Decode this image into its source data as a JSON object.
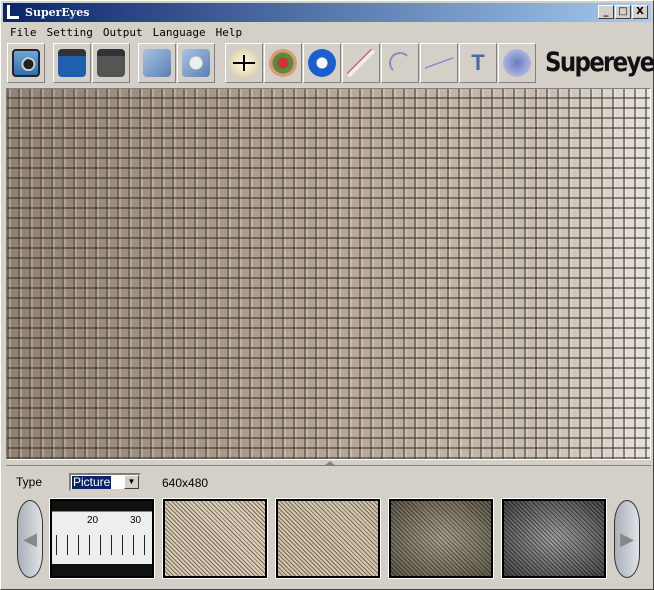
{
  "window": {
    "title": "SuperEyes",
    "minimize": "_",
    "maximize": "□",
    "close": "X"
  },
  "menu": [
    "File",
    "Setting",
    "Output",
    "Language",
    "Help"
  ],
  "toolbar": {
    "buttons": [
      {
        "name": "capture-photo",
        "icon": "camera-icon"
      },
      {
        "name": "start-record",
        "icon": "video-play-icon"
      },
      {
        "name": "stop-record",
        "icon": "video-stop-icon"
      },
      {
        "name": "open-photo-folder",
        "icon": "photo-folder-icon"
      },
      {
        "name": "open-video-folder",
        "icon": "video-folder-icon"
      },
      {
        "name": "crosshair",
        "icon": "crosshair-icon"
      },
      {
        "name": "settings",
        "icon": "gear-icon"
      },
      {
        "name": "play",
        "icon": "play-circle-icon"
      },
      {
        "name": "measure-line",
        "icon": "ruler-icon"
      },
      {
        "name": "measure-arc",
        "icon": "arc-icon"
      },
      {
        "name": "measure-angle",
        "icon": "angle-icon"
      },
      {
        "name": "text",
        "icon": "text-icon",
        "label": "T"
      },
      {
        "name": "overlay",
        "icon": "layers-icon"
      }
    ],
    "logo": "Supereyes"
  },
  "bottom": {
    "type_label": "Type",
    "type_value": "Picture",
    "resolution": "640x480",
    "thumbnails": [
      "ruler",
      "fabric",
      "fabric",
      "fabric-dark",
      "fabric-darker"
    ],
    "ruler_labels": [
      "20",
      "30"
    ],
    "prev": "◀",
    "next": "▶"
  }
}
